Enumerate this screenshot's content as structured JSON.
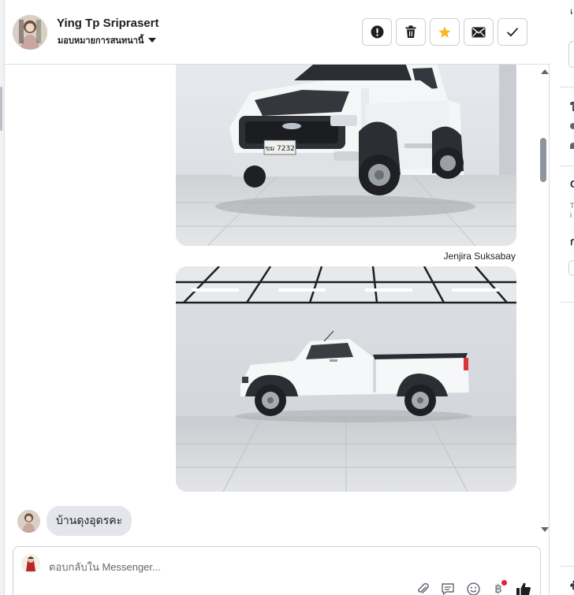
{
  "header": {
    "user_name": "Ying Tp Sriprasert",
    "assign_label": "มอบหมายการสนทนานี้",
    "actions": [
      {
        "icon": "alert-icon",
        "label": "Mark as spam"
      },
      {
        "icon": "trash-icon",
        "label": "Delete"
      },
      {
        "icon": "star-icon",
        "label": "Follow up"
      },
      {
        "icon": "envelope-icon",
        "label": "Mark as unread"
      },
      {
        "icon": "check-icon",
        "label": "Mark as done"
      }
    ]
  },
  "messages": {
    "sender_name": "Jenjira Suksabay",
    "customer_text": "บ้านดุงอุดรคะ",
    "plate_text": "ขม 7232"
  },
  "composer": {
    "placeholder": "ตอบกลับใน Messenger...",
    "tools": [
      "attachment-icon",
      "saved-reply-icon",
      "emoji-icon",
      "baht-payment-icon",
      "like-icon"
    ]
  },
  "right_panel": {
    "letters": [
      "เ",
      "ใ",
      "C",
      "T",
      "i",
      "ก",
      "ข้"
    ]
  },
  "colors": {
    "accent_star": "#f7b928",
    "bubble_bg": "#e4e6eb",
    "border": "#ccd0d5",
    "notification_dot": "#e41e3f"
  }
}
